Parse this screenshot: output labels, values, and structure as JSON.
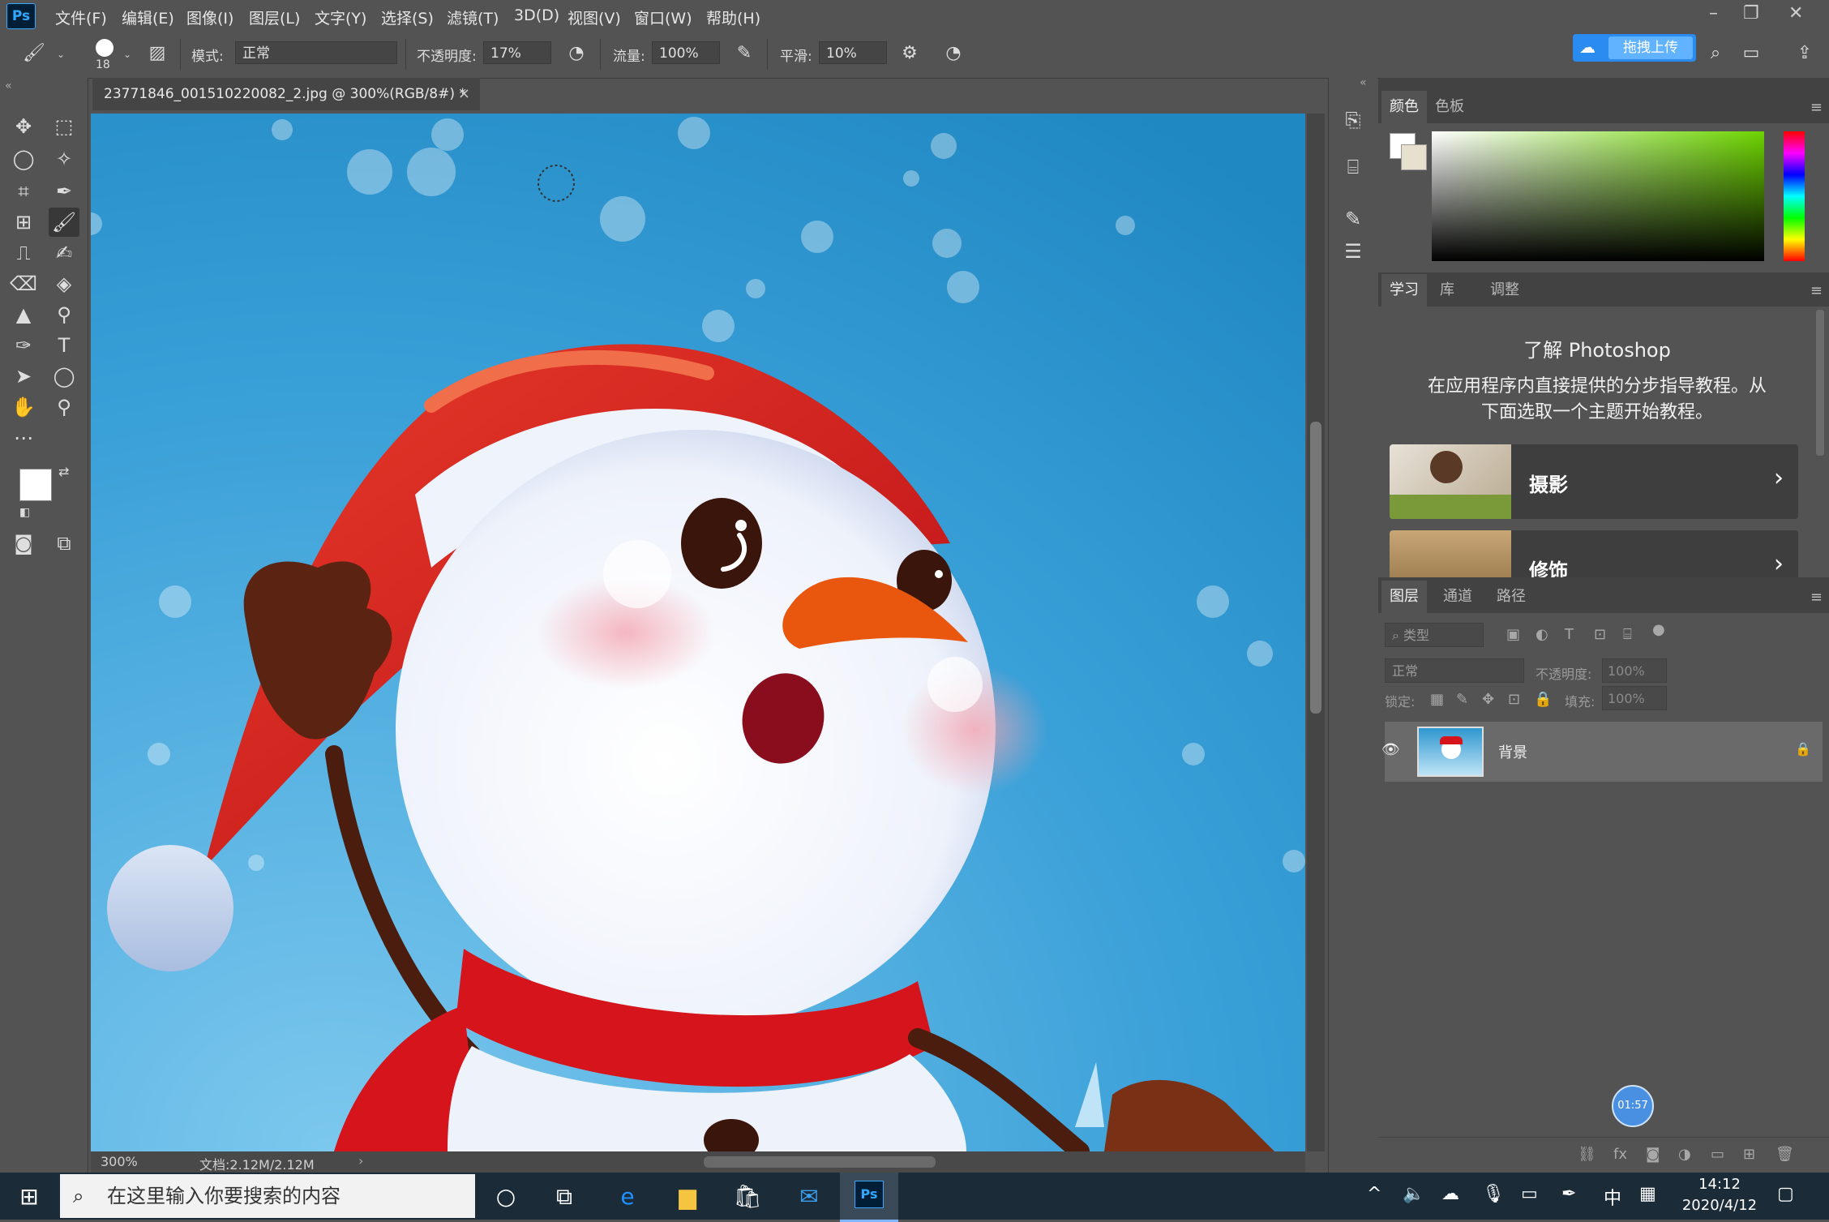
{
  "app": {
    "logo": "Ps"
  },
  "menu": [
    "文件(F)",
    "编辑(E)",
    "图像(I)",
    "图层(L)",
    "文字(Y)",
    "选择(S)",
    "滤镜(T)",
    "3D(D)",
    "视图(V)",
    "窗口(W)",
    "帮助(H)"
  ],
  "options": {
    "brush_size": "18",
    "mode_label": "模式:",
    "mode_value": "正常",
    "opacity_label": "不透明度:",
    "opacity_value": "17%",
    "flow_label": "流量:",
    "flow_value": "100%",
    "smooth_label": "平滑:",
    "smooth_value": "10%",
    "upload_button": "拖拽上传"
  },
  "document": {
    "tab_title": "23771846_001510220082_2.jpg @ 300%(RGB/8#) *",
    "zoom": "300%",
    "doc_size": "文档:2.12M/2.12M"
  },
  "panels": {
    "color_tabs": [
      "颜色",
      "色板"
    ],
    "learn_tabs": [
      "学习",
      "库",
      "调整"
    ],
    "learn_title": "了解 Photoshop",
    "learn_desc_line1": "在应用程序内直接提供的分步指导教程。从",
    "learn_desc_line2": "下面选取一个主题开始教程。",
    "learn_cards": [
      "摄影",
      "修饰"
    ],
    "layer_tabs": [
      "图层",
      "通道",
      "路径"
    ],
    "layer_filter": "类型",
    "blend_mode": "正常",
    "opacity_label": "不透明度:",
    "opacity_value": "100%",
    "lock_label": "锁定:",
    "fill_label": "填充:",
    "fill_value": "100%",
    "layer_name": "背景",
    "timer": "01:57"
  },
  "taskbar": {
    "search_placeholder": "在这里输入你要搜索的内容",
    "ime": "中",
    "time": "14:12",
    "date": "2020/4/12"
  },
  "icons": {
    "brush": "brush-icon",
    "move": "move-icon",
    "marquee": "rect-marquee-icon",
    "lasso": "lasso-icon",
    "magic_wand": "magic-wand-icon",
    "crop": "crop-icon",
    "eyedropper": "eyedropper-icon",
    "text": "type-icon",
    "hand": "hand-icon",
    "zoom": "zoom-icon"
  },
  "colors": {
    "ps_blue": "#31a8ff",
    "canvas_sky": "#2f97cf",
    "scarf_red": "#d6141c"
  }
}
